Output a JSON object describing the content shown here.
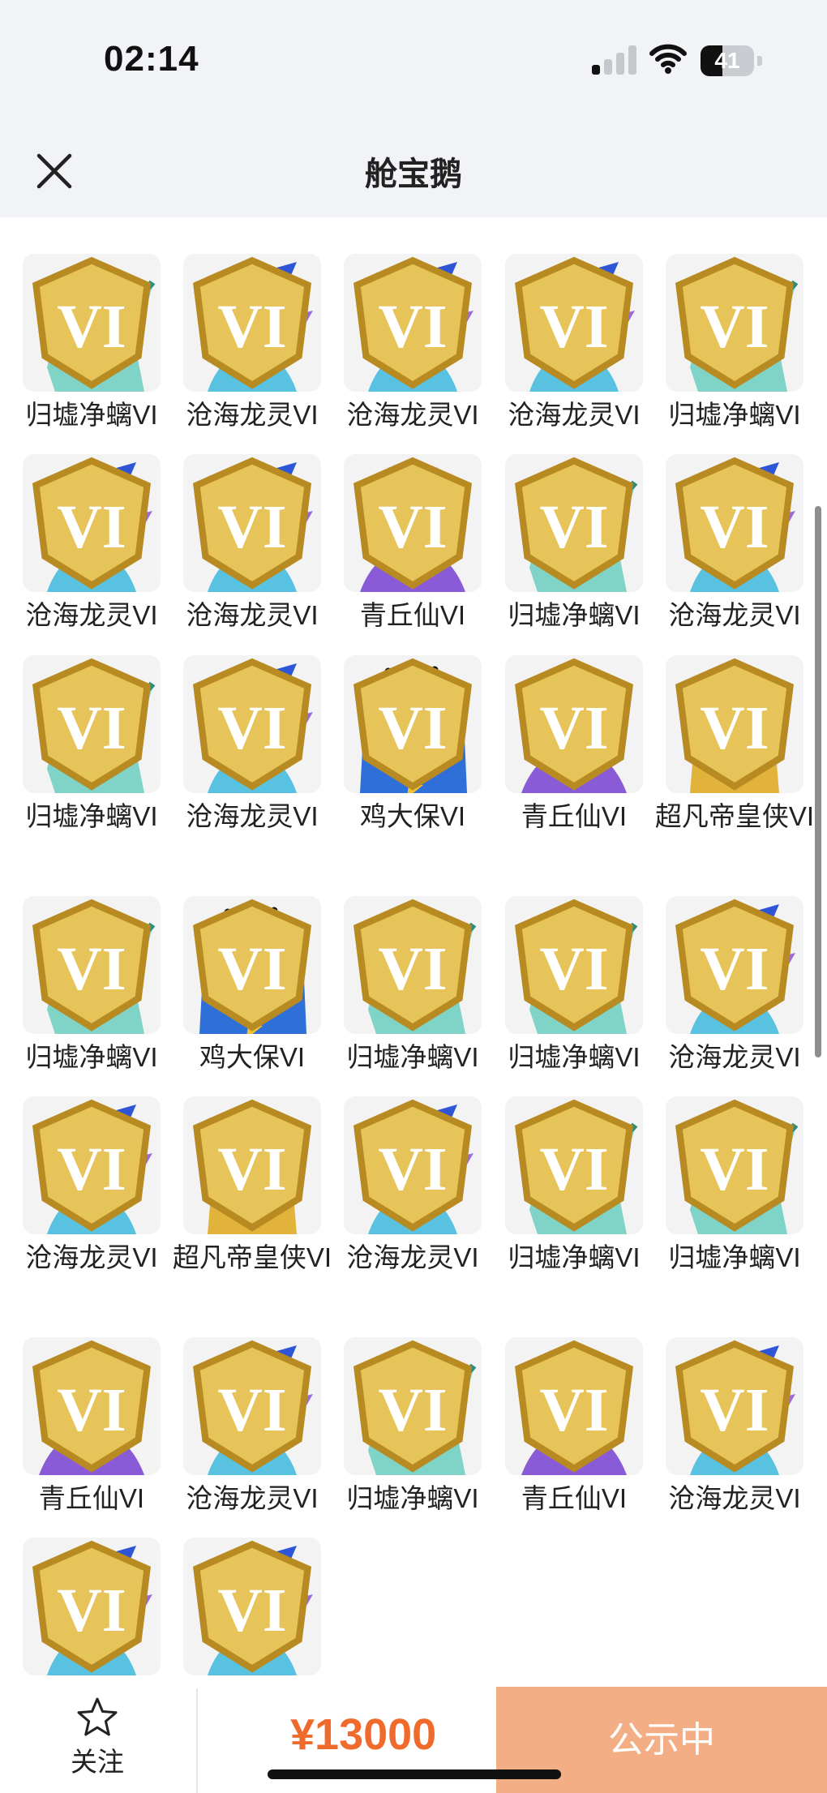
{
  "status_bar": {
    "time": "02:14",
    "battery": "41",
    "battery_level": 0.41,
    "signal_bars": 1
  },
  "header": {
    "title": "舱宝鹅"
  },
  "skins": [
    {
      "name": "归墟净螭VI",
      "avatar": "dragon"
    },
    {
      "name": "沧海龙灵VI",
      "avatar": "boy"
    },
    {
      "name": "沧海龙灵VI",
      "avatar": "boy"
    },
    {
      "name": "沧海龙灵VI",
      "avatar": "boy"
    },
    {
      "name": "归墟净螭VI",
      "avatar": "dragon"
    },
    {
      "name": "沧海龙灵VI",
      "avatar": "boy"
    },
    {
      "name": "沧海龙灵VI",
      "avatar": "boy"
    },
    {
      "name": "青丘仙VI",
      "avatar": "fox"
    },
    {
      "name": "归墟净螭VI",
      "avatar": "dragon"
    },
    {
      "name": "沧海龙灵VI",
      "avatar": "boy"
    },
    {
      "name": "归墟净螭VI",
      "avatar": "dragon"
    },
    {
      "name": "沧海龙灵VI",
      "avatar": "boy"
    },
    {
      "name": "鸡大保VI",
      "avatar": "bird"
    },
    {
      "name": "青丘仙VI",
      "avatar": "fox"
    },
    {
      "name": "超凡帝皇侠VI",
      "avatar": "armor"
    },
    {
      "name": "归墟净螭VI",
      "avatar": "dragon"
    },
    {
      "name": "鸡大保VI",
      "avatar": "bird"
    },
    {
      "name": "归墟净螭VI",
      "avatar": "dragon"
    },
    {
      "name": "归墟净螭VI",
      "avatar": "dragon"
    },
    {
      "name": "沧海龙灵VI",
      "avatar": "boy"
    },
    {
      "name": "沧海龙灵VI",
      "avatar": "boy"
    },
    {
      "name": "超凡帝皇侠VI",
      "avatar": "armor"
    },
    {
      "name": "沧海龙灵VI",
      "avatar": "boy"
    },
    {
      "name": "归墟净螭VI",
      "avatar": "dragon"
    },
    {
      "name": "归墟净螭VI",
      "avatar": "dragon"
    },
    {
      "name": "青丘仙VI",
      "avatar": "fox"
    },
    {
      "name": "沧海龙灵VI",
      "avatar": "boy"
    },
    {
      "name": "归墟净螭VI",
      "avatar": "dragon"
    },
    {
      "name": "青丘仙VI",
      "avatar": "fox"
    },
    {
      "name": "沧海龙灵VI",
      "avatar": "boy"
    },
    {
      "name": "",
      "avatar": "boy"
    },
    {
      "name": "",
      "avatar": "boy"
    }
  ],
  "bottom_bar": {
    "follow_label": "关注",
    "price": "¥13000",
    "status_label": "公示中"
  },
  "colors": {
    "accent": "#f06a2c",
    "status_button": "#f4ae86"
  }
}
